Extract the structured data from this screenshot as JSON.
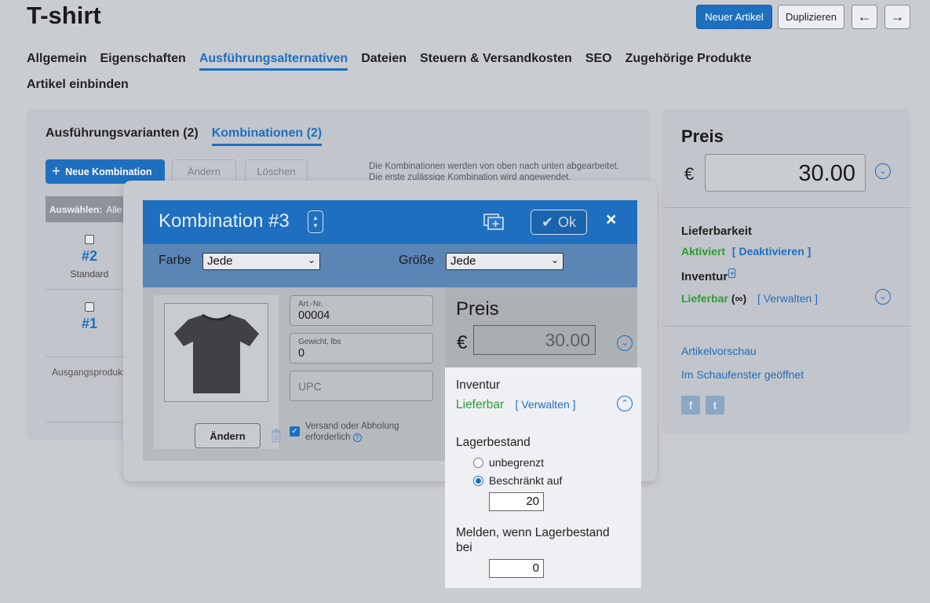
{
  "page": {
    "title": "T-shirt",
    "new_article": "Neuer Artikel",
    "duplicate": "Duplizieren",
    "prev_arrow": "←",
    "next_arrow": "→"
  },
  "tabs": [
    {
      "label": "Allgemein",
      "active": false
    },
    {
      "label": "Eigenschaften",
      "active": false
    },
    {
      "label": "Ausführungsalternativen",
      "active": true
    },
    {
      "label": "Dateien",
      "active": false
    },
    {
      "label": "Steuern & Versandkosten",
      "active": false
    },
    {
      "label": "SEO",
      "active": false
    },
    {
      "label": "Zugehörige Produkte",
      "active": false
    },
    {
      "label": "Artikel einbinden",
      "active": false
    }
  ],
  "variants": {
    "subtab_variants": "Ausführungsvarianten (2)",
    "subtab_combinations": "Kombinationen (2)",
    "new_combination": "Neue Kombination",
    "edit": "Ändern",
    "delete": "Löschen",
    "info_line1": "Die Kombinationen werden von oben nach unten abgearbeitet.",
    "info_line2": "Die erste zulässige Kombination wird angewendet.",
    "select_label": "Auswählen:",
    "select_all": "Alle",
    "items": [
      {
        "number": "#2",
        "label": "Standard"
      },
      {
        "number": "#1",
        "label": ""
      }
    ],
    "base_product": "Ausgangsprodukt"
  },
  "sidebar": {
    "price_heading": "Preis",
    "currency": "€",
    "price_value": "30.00",
    "availability_heading": "Lieferbarkeit",
    "availability_status": "Aktiviert",
    "availability_action": "[ Deaktivieren ]",
    "inventory_heading": "Inventur",
    "inventory_status": "Lieferbar",
    "inventory_infinity": "(∞)",
    "inventory_action": "[ Verwalten ]",
    "preview_link": "Artikelvorschau",
    "storefront_link": "Im Schaufenster geöffnet",
    "facebook": "f",
    "twitter": "t"
  },
  "modal": {
    "title": "Kombination #3",
    "ok_label": "Ok",
    "close": "×",
    "color_label": "Farbe",
    "color_value": "Jede",
    "size_label": "Größe",
    "size_value": "Jede",
    "change_image": "Ändern",
    "sku_label": "Art.-Nr.",
    "sku_value": "00004",
    "weight_label": "Gewicht, lbs",
    "weight_value": "0",
    "upc_placeholder": "UPC",
    "shipping_line1": "Versand oder Abholung",
    "shipping_line2": "erforderlich",
    "price_heading": "Preis",
    "currency": "€",
    "price_value": "30.00"
  },
  "inventory_popup": {
    "heading": "Inventur",
    "status": "Lieferbar",
    "manage": "[ Verwalten ]",
    "stock_heading": "Lagerbestand",
    "unlimited": "unbegrenzt",
    "limited": "Beschränkt auf",
    "limited_value": "20",
    "notify_line1": "Melden, wenn Lagerbestand",
    "notify_line2": "bei",
    "notify_value": "0"
  }
}
